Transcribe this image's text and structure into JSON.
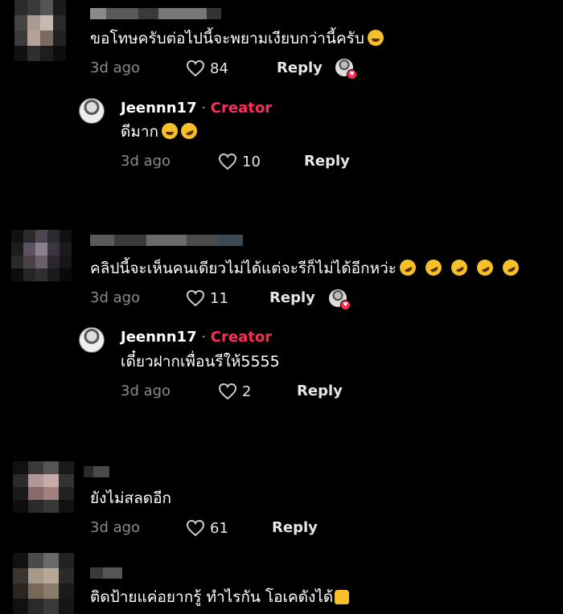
{
  "comments": [
    {
      "text": "ขอโทษครับต่อไปนี้จะพยามเงียบกว่านี้ครับ",
      "time": "3d ago",
      "likes": "84",
      "reply_label": "Reply",
      "reply": {
        "name": "Jeennn17",
        "sep": " · ",
        "badge": "Creator",
        "text": "ดีมาก",
        "time": "3d ago",
        "likes": "10",
        "reply_label": "Reply"
      }
    },
    {
      "text": "คลิปนี้จะเห็นคนเดียวไม่ได้แต่จะรีก็ไม่ได้อีกหว่ะ",
      "time": "3d ago",
      "likes": "11",
      "reply_label": "Reply",
      "reply": {
        "name": "Jeennn17",
        "sep": " · ",
        "badge": "Creator",
        "text": "เดี๋ยวฝากเพื่อนรีให้5555",
        "time": "3d ago",
        "likes": "2",
        "reply_label": "Reply"
      }
    },
    {
      "text": "ยังไม่สลดอีก",
      "time": "3d ago",
      "likes": "61",
      "reply_label": "Reply"
    },
    {
      "text": "ติดป้ายแค่อยากรู้ ทำไรกัน โอเคดังได้"
    }
  ],
  "colors": {
    "background": "#000000",
    "creator": "#fe2c55",
    "meta": "#8a8a8a"
  },
  "icons": [
    "heart-outline-icon",
    "liked-by-creator-icon",
    "grin-emoji-icon",
    "rofl-emoji-icon",
    "thumbs-up-emoji-icon"
  ]
}
